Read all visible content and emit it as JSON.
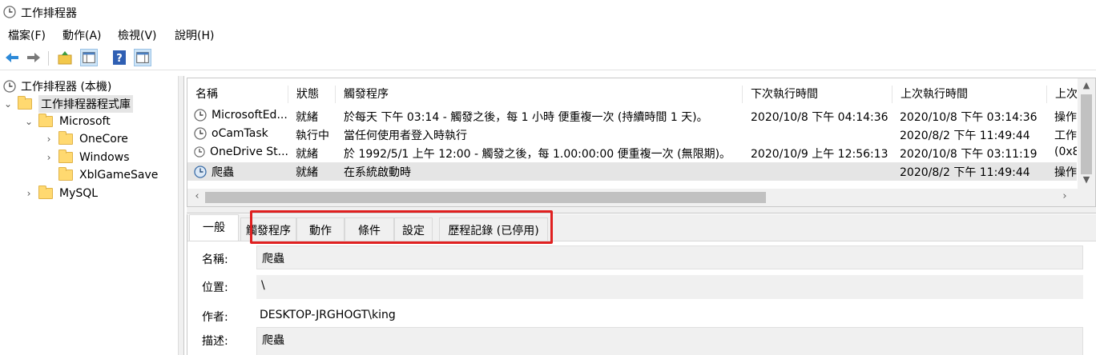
{
  "window": {
    "title": "工作排程器",
    "icon": "clock-icon"
  },
  "menu": [
    "檔案(F)",
    "動作(A)",
    "檢視(V)",
    "說明(H)"
  ],
  "toolbar": {
    "buttons": [
      "back-icon",
      "forward-icon",
      "up-folder-icon",
      "show-hide-console-tree-icon",
      "help-icon",
      "show-hide-action-pane-icon"
    ]
  },
  "tree": {
    "root": "工作排程器 (本機)",
    "library": "工作排程器程式庫",
    "items": [
      {
        "label": "Microsoft",
        "expanded": true
      },
      {
        "label": "OneCore",
        "expanded": false
      },
      {
        "label": "Windows",
        "expanded": false
      },
      {
        "label": "XblGameSave",
        "expanded": false
      },
      {
        "label": "MySQL",
        "expanded": false
      }
    ]
  },
  "task_list": {
    "columns": [
      "名稱",
      "狀態",
      "觸發程序",
      "下次執行時間",
      "上次執行時間",
      "上次"
    ],
    "rows": [
      {
        "name": "MicrosoftEd...",
        "status": "就緒",
        "trigger": "於每天 下午 03:14 - 觸發之後，每 1 小時 便重複一次 (持續時間 1 天)。",
        "next_run": "2020/10/8 下午 04:14:36",
        "last_run": "2020/10/8 下午 03:14:36",
        "last_result": "操作"
      },
      {
        "name": "oCamTask",
        "status": "執行中",
        "trigger": "當任何使用者登入時執行",
        "next_run": "",
        "last_run": "2020/8/2 下午 11:49:44",
        "last_result": "工作"
      },
      {
        "name": "OneDrive St...",
        "status": "就緒",
        "trigger": "於 1992/5/1 上午 12:00 - 觸發之後，每 1.00:00:00 便重複一次 (無限期)。",
        "next_run": "2020/10/9 上午 12:56:13",
        "last_run": "2020/10/8 下午 03:11:19",
        "last_result": "(0x8"
      },
      {
        "name": "爬蟲",
        "status": "就緒",
        "trigger": "在系統啟動時",
        "next_run": "",
        "last_run": "2020/8/2 下午 11:49:44",
        "last_result": "操作"
      }
    ],
    "selected_index": 3
  },
  "detail": {
    "tabs": [
      "一般",
      "觸發程序",
      "動作",
      "條件",
      "設定",
      "歷程記錄 (已停用)"
    ],
    "active_tab": 0,
    "highlight_color": "#e02020",
    "fields": {
      "name_label": "名稱:",
      "name_value": "爬蟲",
      "location_label": "位置:",
      "location_value": "\\",
      "author_label": "作者:",
      "author_value": "DESKTOP-JRGHOGT\\king",
      "description_label": "描述:",
      "description_value": "爬蟲"
    }
  }
}
